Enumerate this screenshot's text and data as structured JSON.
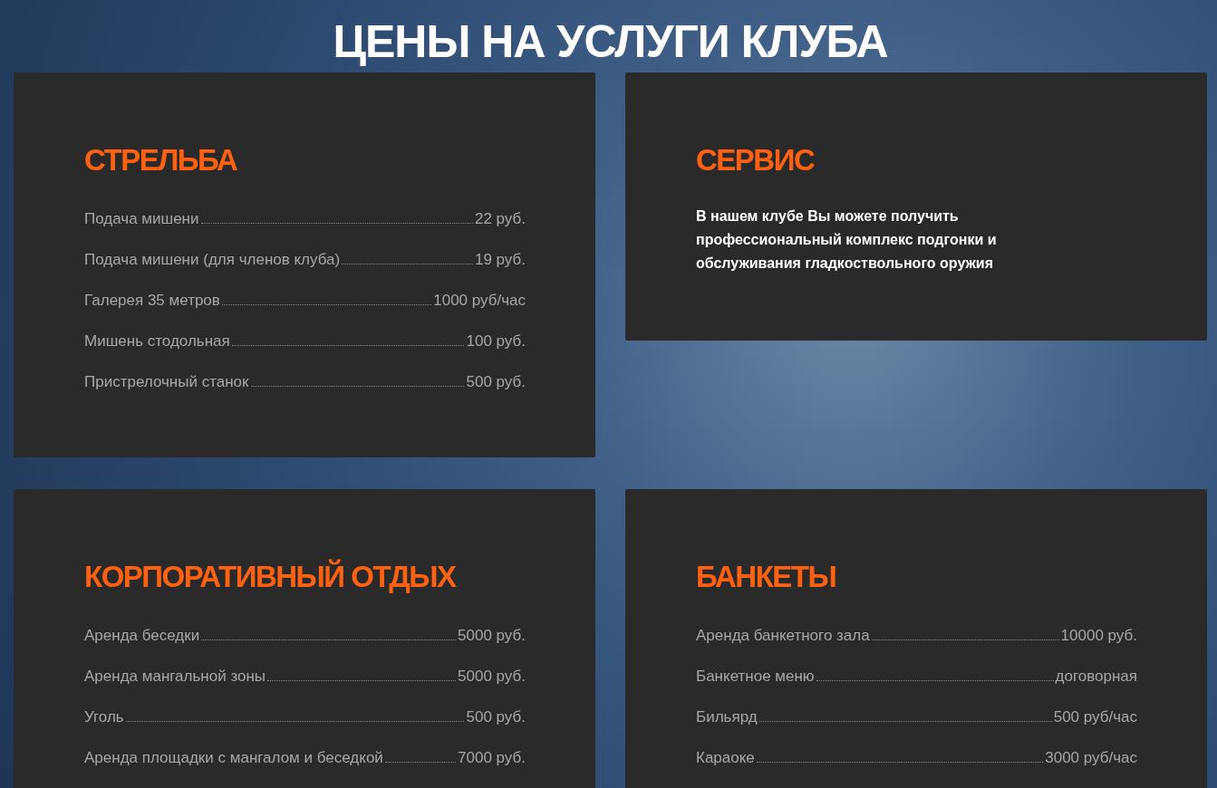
{
  "title": "ЦЕНЫ НА УСЛУГИ КЛУБА",
  "cards": [
    {
      "kind": "prices",
      "title": "СТРЕЛЬБА",
      "items": [
        {
          "name": "Подача мишени",
          "price": "22 руб."
        },
        {
          "name": "Подача мишени (для членов клуба)",
          "price": "19 руб."
        },
        {
          "name": "Галерея 35 метров",
          "price": "1000 руб/час"
        },
        {
          "name": "Мишень стодольная",
          "price": "100 руб."
        },
        {
          "name": "Пристрелочный станок",
          "price": "500 руб."
        }
      ]
    },
    {
      "kind": "text",
      "title": "СЕРВИС",
      "text": "В нашем клубе Вы можете получить профессиональный комплекс подгонки и обслуживания гладкоствольного оружия"
    },
    {
      "kind": "prices",
      "title": "КОРПОРАТИВНЫЙ ОТДЫХ",
      "items": [
        {
          "name": "Аренда беседки",
          "price": "5000 руб."
        },
        {
          "name": "Аренда мангальной зоны",
          "price": "5000 руб."
        },
        {
          "name": "Уголь",
          "price": "500 руб."
        },
        {
          "name": "Аренда площадки с мангалом и беседкой",
          "price": "7000 руб."
        }
      ]
    },
    {
      "kind": "prices",
      "title": "БАНКЕТЫ",
      "items": [
        {
          "name": "Аренда банкетного зала",
          "price": "10000 руб."
        },
        {
          "name": "Банкетное меню",
          "price": "договорная"
        },
        {
          "name": "Бильярд",
          "price": "500 руб/час"
        },
        {
          "name": "Караоке",
          "price": "3000 руб/час"
        }
      ]
    }
  ]
}
